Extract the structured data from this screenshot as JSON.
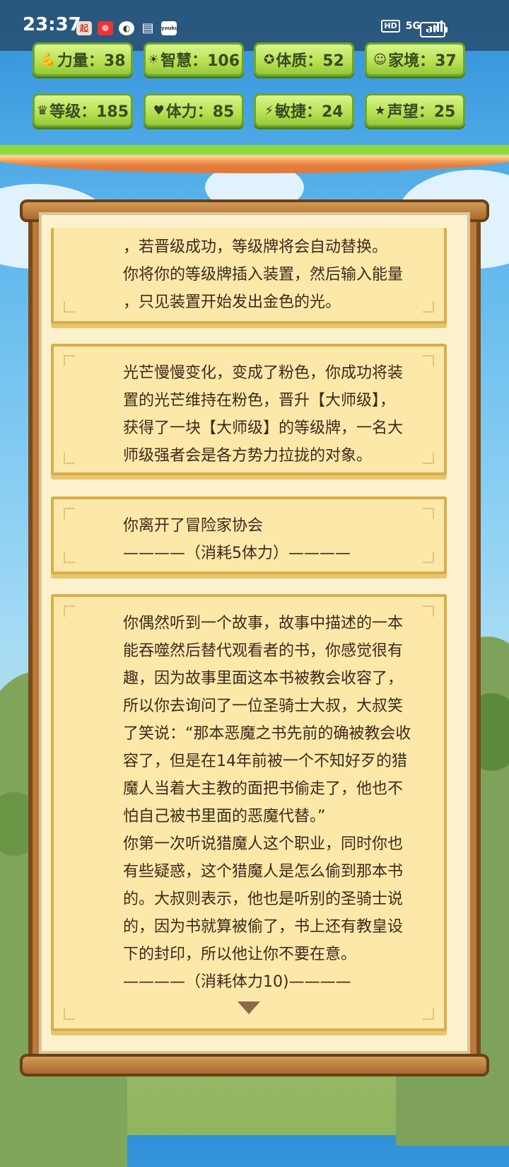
{
  "status_bar": {
    "time": "23:37",
    "app_icons": [
      {
        "name": "qidian-app-icon",
        "label": "起"
      },
      {
        "name": "red-app-icon",
        "label": "❁"
      },
      {
        "name": "speed-app-icon",
        "label": "◐"
      },
      {
        "name": "book-app-icon",
        "label": "▤"
      },
      {
        "name": "youku-app-icon",
        "label": "youku"
      }
    ],
    "hd": "HD",
    "network": "5G",
    "battery": "37"
  },
  "stats": [
    {
      "id": "strength",
      "icon": "muscle-icon",
      "glyph": "💪",
      "label": "力量：38"
    },
    {
      "id": "wisdom",
      "icon": "sun-icon",
      "glyph": "☀",
      "label": "智慧：106"
    },
    {
      "id": "constitution",
      "icon": "shield-icon",
      "glyph": "✪",
      "label": "体质：52"
    },
    {
      "id": "family",
      "icon": "family-icon",
      "glyph": "☺",
      "label": "家境：37"
    },
    {
      "id": "level",
      "icon": "crown-icon",
      "glyph": "♛",
      "label": "等级：185"
    },
    {
      "id": "stamina",
      "icon": "heart-icon",
      "glyph": "♥",
      "label": "体力：85"
    },
    {
      "id": "agility",
      "icon": "lightning-icon",
      "glyph": "⚡",
      "label": "敏捷：24"
    },
    {
      "id": "reputation",
      "icon": "star-icon",
      "glyph": "★",
      "label": "声望：25"
    }
  ],
  "story": [
    {
      "lines": [
        "，若晋级成功，等级牌将会自动替换。",
        "你将你的等级牌插入装置，然后输入能量",
        "，只见装置开始发出金色的光。"
      ]
    },
    {
      "lines": [
        "光芒慢慢变化，变成了粉色，你成功将装",
        "置的光芒维持在粉色，晋升【大师级】，",
        "获得了一块【大师级】的等级牌，一名大",
        "师级强者会是各方势力拉拢的对象。"
      ]
    },
    {
      "lines": [
        "你离开了冒险家协会",
        "————（消耗5体力）————"
      ]
    },
    {
      "lines": [
        "你偶然听到一个故事，故事中描述的一本",
        "能吞噬然后替代观看者的书，你感觉很有",
        "趣，因为故事里面这本书被教会收容了，",
        "所以你去询问了一位圣骑士大叔，大叔笑",
        "了笑说：“那本恶魔之书先前的确被教会收",
        "容了，但是在14年前被一个不知好歹的猎",
        "魔人当着大主教的面把书偷走了，他也不",
        "怕自己被书里面的恶魔代替。”",
        "你第一次听说猎魔人这个职业，同时你也",
        "有些疑惑，这个猎魔人是怎么偷到那本书",
        "的。大叔则表示，他也是听别的圣骑士说",
        "的，因为书就算被偷了，书上还有教皇设",
        "下的封印，所以他让你不要在意。",
        "————（消耗体力10)————"
      ]
    }
  ]
}
